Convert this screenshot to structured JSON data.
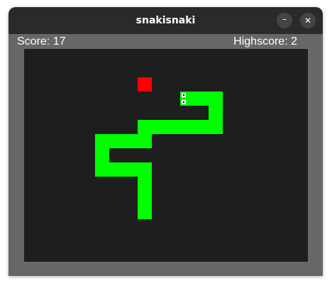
{
  "window": {
    "title": "snakisnaki",
    "minimize_glyph": "–",
    "close_glyph": "✕"
  },
  "hud": {
    "score_label": "Score: 17",
    "highscore_label": "Highscore: 2",
    "score": 17,
    "highscore": 2
  },
  "game": {
    "grid": {
      "cols": 20,
      "rows": 15
    },
    "food": [
      8,
      2
    ],
    "snake": [
      [
        11,
        3
      ],
      [
        12,
        3
      ],
      [
        13,
        3
      ],
      [
        13,
        4
      ],
      [
        13,
        5
      ],
      [
        12,
        5
      ],
      [
        11,
        5
      ],
      [
        10,
        5
      ],
      [
        9,
        5
      ],
      [
        8,
        5
      ],
      [
        8,
        6
      ],
      [
        7,
        6
      ],
      [
        6,
        6
      ],
      [
        5,
        6
      ],
      [
        5,
        7
      ],
      [
        5,
        8
      ],
      [
        6,
        8
      ],
      [
        7,
        8
      ],
      [
        8,
        8
      ],
      [
        8,
        9
      ],
      [
        8,
        10
      ],
      [
        8,
        11
      ]
    ],
    "colors": {
      "background": "#1e1e1e",
      "border": "#676767",
      "snake": "#00ff00",
      "food": "#ff0000",
      "eye_white": "#ffffff",
      "eye_pupil": "#000000"
    }
  }
}
